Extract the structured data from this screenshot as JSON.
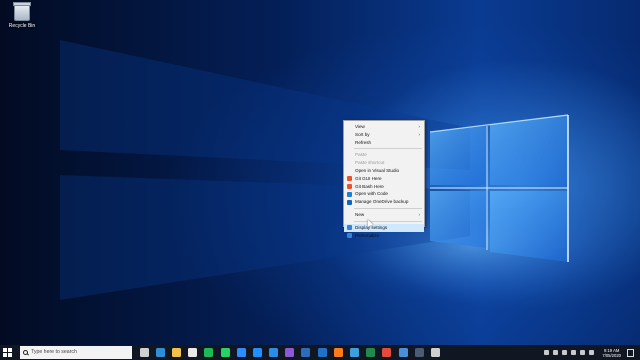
{
  "desktop": {
    "icons": [
      {
        "label": "Recycle Bin"
      }
    ]
  },
  "context_menu": {
    "items": [
      {
        "label": "View",
        "submenu": true,
        "disabled": false,
        "icon": ""
      },
      {
        "label": "Sort by",
        "submenu": true,
        "disabled": false,
        "icon": ""
      },
      {
        "label": "Refresh",
        "submenu": false,
        "disabled": false,
        "icon": ""
      },
      {
        "separator": true
      },
      {
        "label": "Paste",
        "submenu": false,
        "disabled": true,
        "icon": ""
      },
      {
        "label": "Paste shortcut",
        "submenu": false,
        "disabled": true,
        "icon": ""
      },
      {
        "label": "Open in Visual Studio",
        "submenu": false,
        "disabled": false,
        "icon": ""
      },
      {
        "label": "Git GUI Here",
        "submenu": false,
        "disabled": false,
        "icon": "git-icon"
      },
      {
        "label": "Git Bash Here",
        "submenu": false,
        "disabled": false,
        "icon": "git-icon"
      },
      {
        "label": "Open with Code",
        "submenu": false,
        "disabled": false,
        "icon": "vscode-icon"
      },
      {
        "label": "Manage OneDrive backup",
        "submenu": false,
        "disabled": false,
        "icon": "onedrive-icon"
      },
      {
        "separator": true
      },
      {
        "label": "New",
        "submenu": true,
        "disabled": false,
        "icon": ""
      },
      {
        "separator": true
      },
      {
        "label": "Display settings",
        "submenu": false,
        "disabled": false,
        "icon": "display-icon",
        "highlighted": true
      },
      {
        "label": "Personalize",
        "submenu": false,
        "disabled": false,
        "icon": "personalize-icon"
      }
    ]
  },
  "taskbar": {
    "search_placeholder": "Type here to search",
    "pinned": [
      {
        "icon": "task-view-icon",
        "color": "#d0d0d0"
      },
      {
        "icon": "edge-icon",
        "color": "#2f8ed8"
      },
      {
        "icon": "file-explorer-icon",
        "color": "#f2c14b"
      },
      {
        "icon": "store-icon",
        "color": "#e9e9e9"
      },
      {
        "icon": "spotify-icon",
        "color": "#1db954"
      },
      {
        "icon": "whatsapp-icon",
        "color": "#25d366"
      },
      {
        "icon": "zoom-icon",
        "color": "#2d8cff"
      },
      {
        "icon": "messenger-icon",
        "color": "#1e90ff"
      },
      {
        "icon": "vscode-icon",
        "color": "#2a8be8"
      },
      {
        "icon": "visual-studio-icon",
        "color": "#8a5ad6"
      },
      {
        "icon": "powershell-icon",
        "color": "#2b6dbb"
      },
      {
        "icon": "outlook-icon",
        "color": "#1d73c9"
      },
      {
        "icon": "firefox-icon",
        "color": "#ff7a1a"
      },
      {
        "icon": "paint-icon",
        "color": "#3d9fe0"
      },
      {
        "icon": "excel-icon",
        "color": "#1f8a4c"
      },
      {
        "icon": "chrome-icon",
        "color": "#e54a3b"
      },
      {
        "icon": "photos-icon",
        "color": "#4a90d9"
      },
      {
        "icon": "terminal-icon",
        "color": "#4a5c73"
      },
      {
        "icon": "settings-icon",
        "color": "#cfcfcf"
      }
    ],
    "clock_time": "9:19 AM",
    "clock_date": "7/05/2020"
  },
  "colors": {
    "menu_highlight": "#cde8ff",
    "taskbar_bg": "#101622"
  }
}
